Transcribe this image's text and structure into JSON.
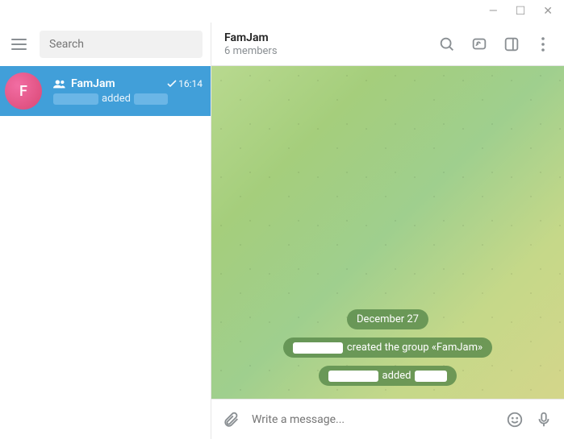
{
  "window": {
    "min": "—",
    "max": "☐",
    "close": "✕"
  },
  "sidebar": {
    "searchPlaceholder": "Search",
    "item": {
      "avatarLetter": "F",
      "name": "FamJam",
      "time": "16:14",
      "previewMiddle": "added"
    }
  },
  "chat": {
    "title": "FamJam",
    "subtitle": "6 members",
    "datePill": "December 27",
    "createdSuffix": "created the group «FamJam»",
    "addedMiddle": "added",
    "composerPlaceholder": "Write a message..."
  }
}
